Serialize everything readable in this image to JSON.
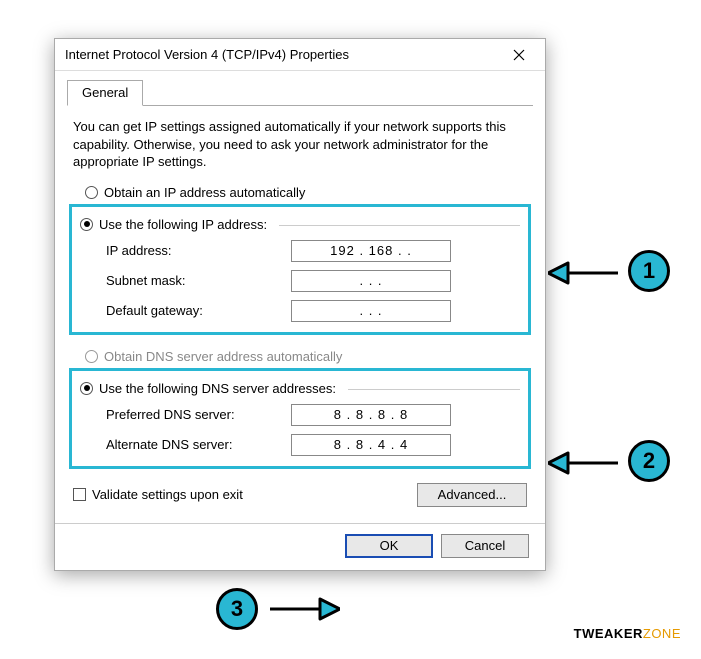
{
  "title": "Internet Protocol Version 4 (TCP/IPv4) Properties",
  "tab": {
    "general": "General"
  },
  "description": "You can get IP settings assigned automatically if your network supports this capability. Otherwise, you need to ask your network administrator for the appropriate IP settings.",
  "ip": {
    "auto_label": "Obtain an IP address automatically",
    "manual_label": "Use the following IP address:",
    "address_label": "IP address:",
    "address_value": "192 . 168 .       .",
    "subnet_label": "Subnet mask:",
    "subnet_value": ".       .       .",
    "gateway_label": "Default gateway:",
    "gateway_value": ".       .       ."
  },
  "dns": {
    "auto_label": "Obtain DNS server address automatically",
    "manual_label": "Use the following DNS server addresses:",
    "preferred_label": "Preferred DNS server:",
    "preferred_value": "8  .  8  .  8  .  8",
    "alternate_label": "Alternate DNS server:",
    "alternate_value": "8  .  8  .  4  .  4"
  },
  "validate_label": "Validate settings upon exit",
  "advanced_label": "Advanced...",
  "ok_label": "OK",
  "cancel_label": "Cancel",
  "annotations": {
    "one": "1",
    "two": "2",
    "three": "3"
  },
  "watermark": {
    "brand": "TWEAKER",
    "suffix": "ZONE"
  }
}
